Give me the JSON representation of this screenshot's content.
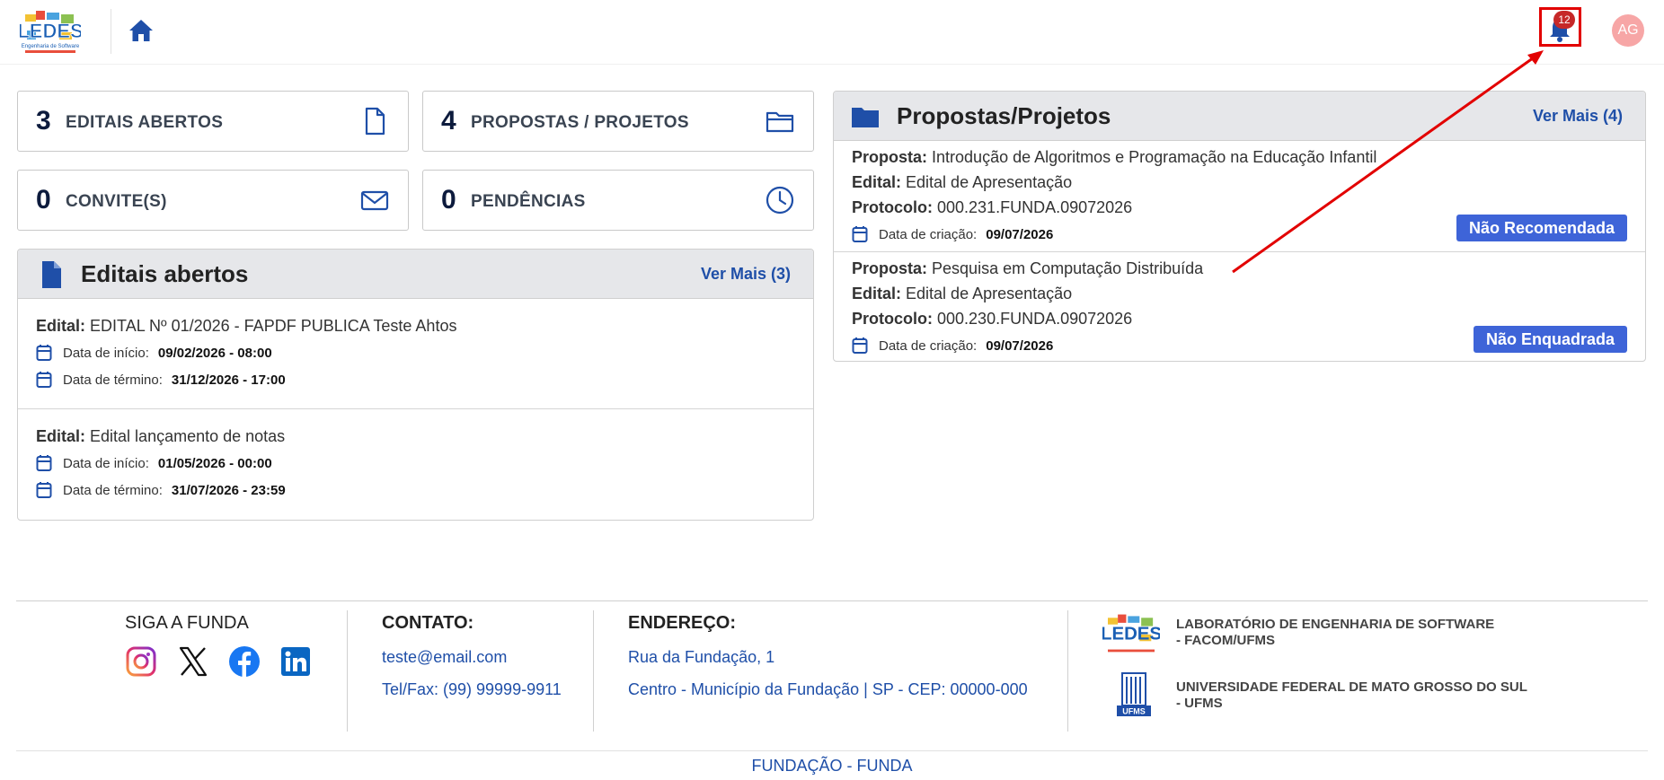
{
  "header": {
    "notifications_count": "12",
    "avatar_initials": "AG",
    "logo_text": "LEDES",
    "logo_subtext": "Engenharia de Software"
  },
  "stats": [
    {
      "count": "3",
      "label": "EDITAIS ABERTOS",
      "icon": "file-icon"
    },
    {
      "count": "4",
      "label": "PROPOSTAS / PROJETOS",
      "icon": "folder-icon"
    },
    {
      "count": "0",
      "label": "CONVITE(S)",
      "icon": "envelope-icon"
    },
    {
      "count": "0",
      "label": "PENDÊNCIAS",
      "icon": "clock-icon"
    }
  ],
  "editais": {
    "title": "Editais abertos",
    "more": "Ver Mais (3)",
    "items": [
      {
        "edital_label": "Edital:",
        "edital": "EDITAL Nº 01/2026 - FAPDF PUBLICA Teste Ahtos",
        "inicio_label": "Data de início:",
        "inicio": "09/02/2026 - 08:00",
        "termino_label": "Data de término:",
        "termino": "31/12/2026 - 17:00"
      },
      {
        "edital_label": "Edital:",
        "edital": "Edital lançamento de notas",
        "inicio_label": "Data de início:",
        "inicio": "01/05/2026 - 00:00",
        "termino_label": "Data de término:",
        "termino": "31/07/2026 - 23:59"
      }
    ]
  },
  "propostas": {
    "title": "Propostas/Projetos",
    "more": "Ver Mais (4)",
    "items": [
      {
        "proposta_label": "Proposta:",
        "proposta": "Introdução de Algoritmos e Programação na Educação Infantil",
        "edital_label": "Edital:",
        "edital": "Edital de Apresentação",
        "protocolo_label": "Protocolo:",
        "protocolo": "000.231.FUNDA.09072026",
        "criacao_label": "Data de criação:",
        "criacao": "09/07/2026",
        "status": "Não Recomendada"
      },
      {
        "proposta_label": "Proposta:",
        "proposta": "Pesquisa em Computação Distribuída",
        "edital_label": "Edital:",
        "edital": "Edital de Apresentação",
        "protocolo_label": "Protocolo:",
        "protocolo": "000.230.FUNDA.09072026",
        "criacao_label": "Data de criação:",
        "criacao": "09/07/2026",
        "status": "Não Enquadrada"
      }
    ]
  },
  "footer": {
    "follow_title": "SIGA A FUNDA",
    "contact_title": "CONTATO:",
    "email": "teste@email.com",
    "phone": "Tel/Fax: (99) 99999-9911",
    "address_title": "ENDEREÇO:",
    "address_line1": "Rua da Fundação, 1",
    "address_line2": "Centro - Município da Fundação | SP - CEP: 00000-000",
    "inst1_line1": "LABORATÓRIO DE ENGENHARIA DE SOFTWARE",
    "inst1_line2": "- FACOM/UFMS",
    "inst2_line1": "UNIVERSIDADE FEDERAL DE MATO GROSSO DO SUL",
    "inst2_line2": "- UFMS",
    "inst2_logo_text": "UFMS",
    "brand": "FUNDAÇÃO - FUNDA"
  },
  "colors": {
    "accent_blue": "#1f4fa8",
    "status_blue": "#3e64d8",
    "badge_red": "#c62828",
    "highlight_red": "#e20000"
  }
}
